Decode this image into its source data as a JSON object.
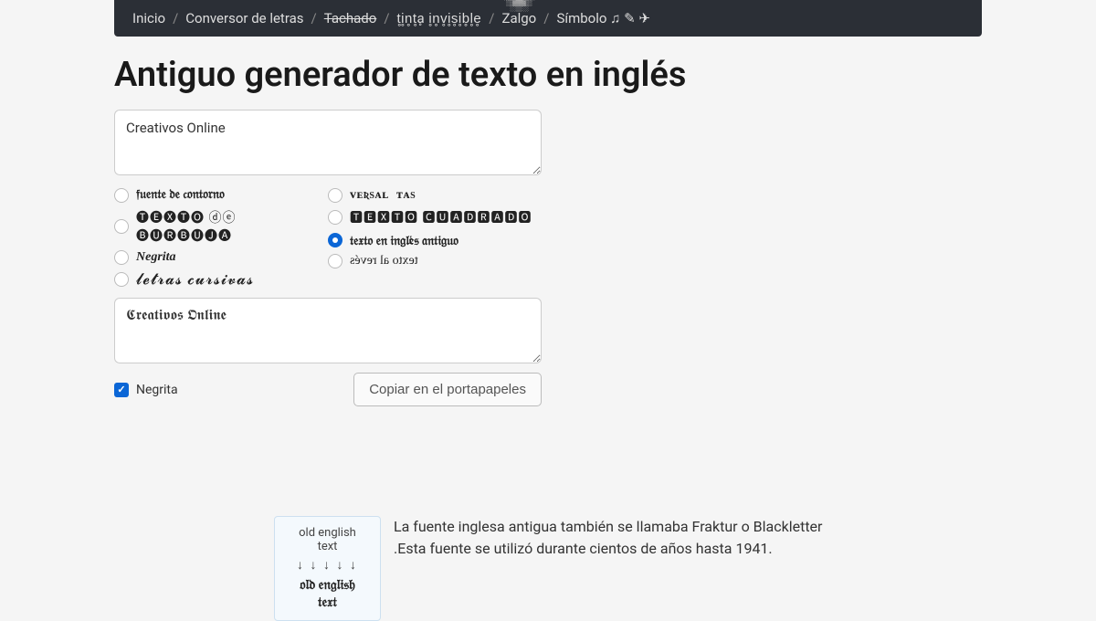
{
  "breadcrumb": {
    "home": "Inicio",
    "converter": "Conversor de letras",
    "strike": "Tachado",
    "invisible": "t̥i̥n̥t̥ḁ i̥n̥v̥i̥s̥i̥b̥l̥e̥",
    "zalgo": "Zalgo",
    "symbol": "Símbolo ♫ ✎ ✈"
  },
  "title": "Antiguo generador de texto en inglés",
  "input_value": "Creativos Online",
  "options": {
    "col1": {
      "outline": "𝔣𝔲𝔢𝔫𝔱𝔢 𝔡𝔢 𝔠𝔬𝔫𝔱𝔬𝔯𝔫𝔬",
      "bubble": "🅣🅔🅧🅣🅞 ⓓⓔ 🅑🅤🅡🅑🅤🅙🅐",
      "bold": "Negrita",
      "cursive": "𝓵𝓮𝓽𝓻𝓪𝓼 𝓬𝓾𝓻𝓼𝓲𝓿𝓪𝓼"
    },
    "col2": {
      "smallcaps": "ᴠᴇʀsᴀʟɪᴛᴀs",
      "square": "🆃🅴🆇🆃🅾 🅲🆄🅰🅳🆁🅰🅳🅾",
      "oldeng": "𝔱𝔢𝔵𝔱𝔬 𝔢𝔫 𝔦𝔫𝔤𝔩é𝔰 𝔞𝔫𝔱𝔦𝔤𝔲𝔬",
      "reverse": "texto al revés"
    }
  },
  "output_value": "𝕮𝖗𝖊𝖆𝖙𝖎𝖛𝖔𝖘 𝕺𝖓𝖑𝖎𝖓𝖊",
  "bold_checkbox_label": "Negrita",
  "copy_label": "Copiar en el portapapeles",
  "info_card": {
    "line1": "old english text",
    "line2": "↓ ↓ ↓ ↓ ↓",
    "line3": "𝔬𝔩𝔡 𝔢𝔫𝔤𝔩𝔦𝔰𝔥 𝔱𝔢𝔵𝔱"
  },
  "info_text": "La fuente inglesa antigua también se llamaba Fraktur o Blackletter .Esta fuente se utilizó durante cientos de años hasta 1941."
}
